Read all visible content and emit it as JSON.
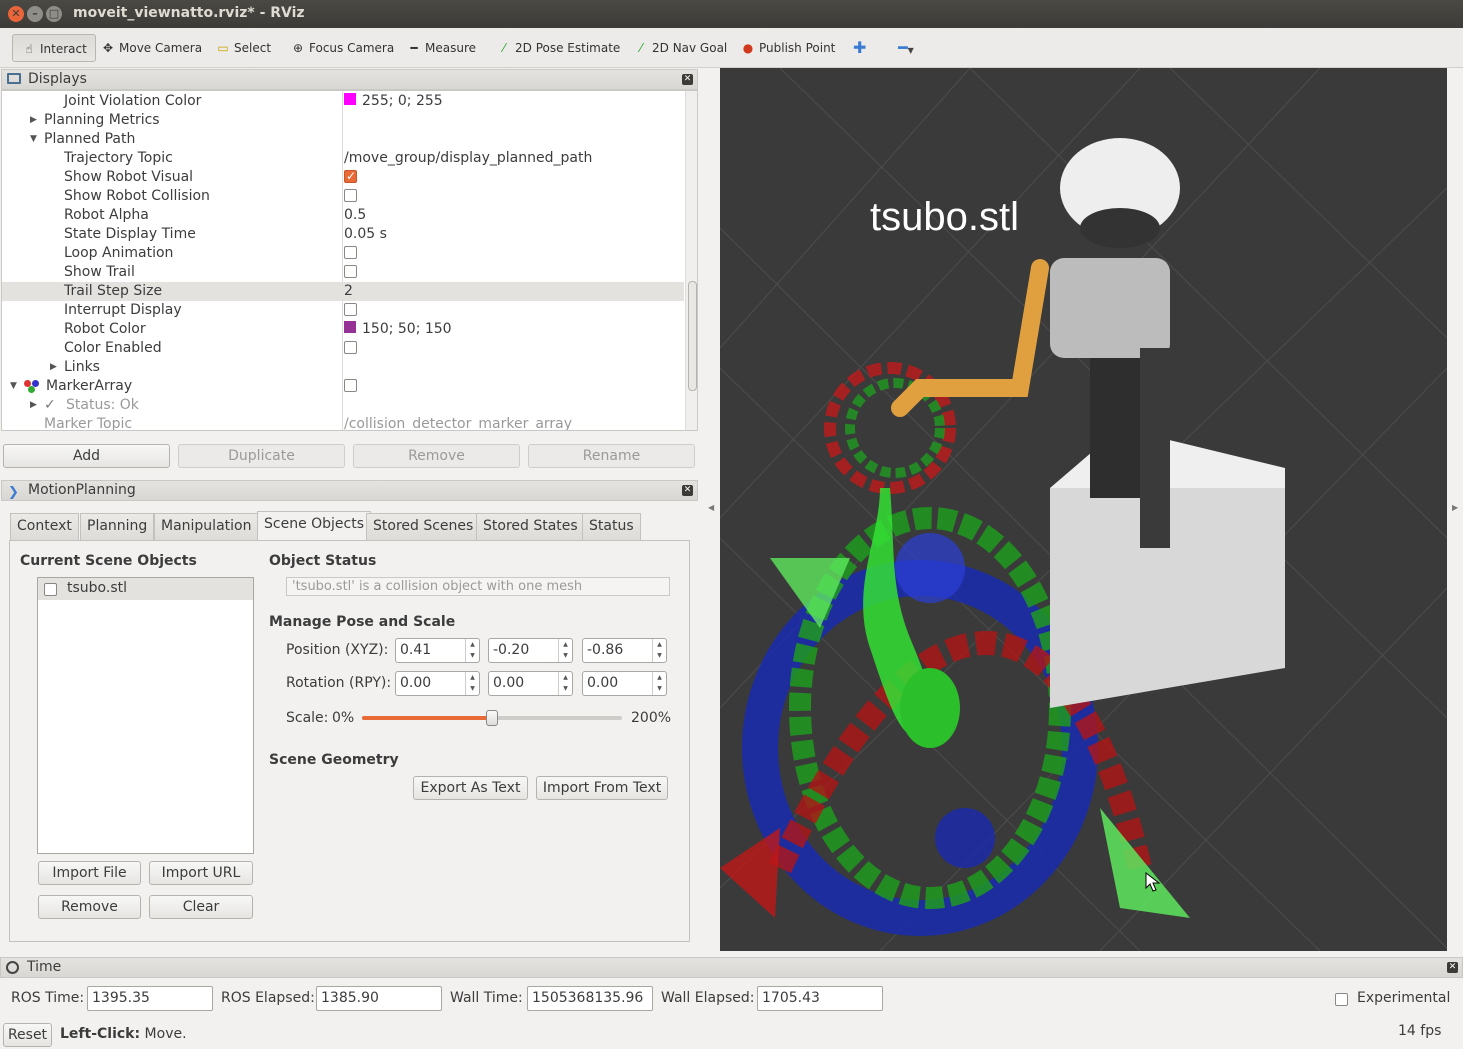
{
  "window": {
    "title": "moveit_viewnatto.rviz* - RViz"
  },
  "toolbar": {
    "tools": [
      "Interact",
      "Move Camera",
      "Select",
      "Focus Camera",
      "Measure",
      "2D Pose Estimate",
      "2D Nav Goal",
      "Publish Point"
    ]
  },
  "displays": {
    "title": "Displays",
    "rows": [
      {
        "key": "Joint Violation Color",
        "value": "255; 0; 255"
      },
      {
        "key": "Planning Metrics",
        "value": ""
      },
      {
        "key": "Planned Path",
        "value": ""
      },
      {
        "key": "Trajectory Topic",
        "value": "/move_group/display_planned_path"
      },
      {
        "key": "Show Robot Visual",
        "value": ""
      },
      {
        "key": "Show Robot Collision",
        "value": ""
      },
      {
        "key": "Robot Alpha",
        "value": "0.5"
      },
      {
        "key": "State Display Time",
        "value": "0.05 s"
      },
      {
        "key": "Loop Animation",
        "value": ""
      },
      {
        "key": "Show Trail",
        "value": ""
      },
      {
        "key": "Trail Step Size",
        "value": "2"
      },
      {
        "key": "Interrupt Display",
        "value": ""
      },
      {
        "key": "Robot Color",
        "value": "150; 50; 150"
      },
      {
        "key": "Color Enabled",
        "value": ""
      },
      {
        "key": "Links",
        "value": ""
      },
      {
        "key": "MarkerArray",
        "value": ""
      },
      {
        "key": "Status: Ok",
        "value": ""
      },
      {
        "key": "Marker Topic",
        "value": "/collision_detector_marker_array"
      }
    ],
    "buttons": {
      "add": "Add",
      "duplicate": "Duplicate",
      "remove": "Remove",
      "rename": "Rename"
    },
    "colors": {
      "joint_violation": "#ff00ff",
      "robot_color": "#963296"
    }
  },
  "motion": {
    "title": "MotionPlanning",
    "tabs": [
      "Context",
      "Planning",
      "Manipulation",
      "Scene Objects",
      "Stored Scenes",
      "Stored States",
      "Status"
    ],
    "active_tab": "Scene Objects",
    "scene": {
      "current_label": "Current Scene Objects",
      "objects": [
        "tsubo.stl"
      ],
      "import_file": "Import File",
      "import_url": "Import URL",
      "remove": "Remove",
      "clear": "Clear",
      "status_label": "Object Status",
      "status_text": "'tsubo.stl' is a collision object with one mesh",
      "manage_label": "Manage Pose and Scale",
      "position_label": "Position (XYZ):",
      "position": [
        "0.41",
        "-0.20",
        "-0.86"
      ],
      "rotation_label": "Rotation (RPY):",
      "rotation": [
        "0.00",
        "0.00",
        "0.00"
      ],
      "scale_label": "Scale:",
      "scale_min": "0%",
      "scale_max": "200%",
      "scale_value": 0.5,
      "geometry_label": "Scene Geometry",
      "export": "Export As Text",
      "import": "Import From Text"
    }
  },
  "viewport": {
    "overlay_text": "tsubo.stl"
  },
  "time": {
    "title": "Time",
    "ros_time_label": "ROS Time:",
    "ros_time": "1395.35",
    "ros_elapsed_label": "ROS Elapsed:",
    "ros_elapsed": "1385.90",
    "wall_time_label": "Wall Time:",
    "wall_time": "1505368135.96",
    "wall_elapsed_label": "Wall Elapsed:",
    "wall_elapsed": "1705.43",
    "experimental": "Experimental"
  },
  "status": {
    "reset": "Reset",
    "hint_bold": "Left-Click:",
    "hint": " Move.",
    "fps": "14 fps"
  }
}
